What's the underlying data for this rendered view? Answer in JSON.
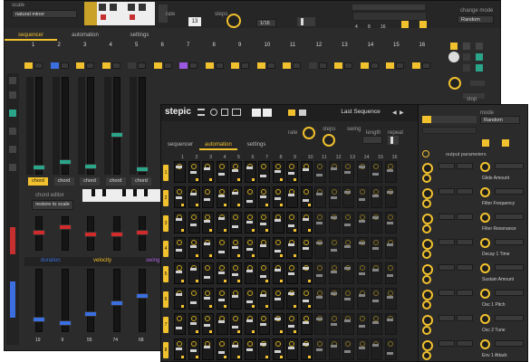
{
  "back": {
    "scale_label": "scale",
    "scale_value": "natural minor",
    "tabs": [
      "sequencer",
      "automation",
      "settings"
    ],
    "active_tab": 0,
    "track_numbers": [
      "1",
      "2",
      "3",
      "4",
      "5",
      "6",
      "7",
      "8",
      "9",
      "10",
      "11",
      "12",
      "13",
      "14",
      "15",
      "16"
    ],
    "value_readout": "13",
    "rate_label": "rate",
    "steps_label": "steps",
    "rate_value": "1/16",
    "chord_btn": "chord",
    "chord_editor_label": "chord editor",
    "restore_btn": "restore to scale",
    "section_tabs": [
      "duration",
      "velocity",
      "swing"
    ],
    "section_colors": [
      "#3b6fe0",
      "#f2c12e",
      "#b36ae8"
    ],
    "bottom_values": [
      "19",
      "9",
      "55",
      "74",
      "68",
      "38",
      "33",
      "74"
    ],
    "right_labels": [
      "change mode",
      "Random"
    ],
    "right_small": [
      "stop"
    ],
    "gray_labels": [
      "4",
      "8",
      "16"
    ]
  },
  "front": {
    "logo": "stepic",
    "preset_name": "Last Sequence",
    "tabs": [
      "sequencer",
      "automation",
      "settings"
    ],
    "labels": [
      "rate",
      "steps",
      "swing",
      "length",
      "repeat"
    ],
    "step_numbers": [
      "1",
      "2",
      "3",
      "4",
      "5",
      "6",
      "7",
      "8",
      "9",
      "10",
      "11",
      "12",
      "13",
      "14",
      "15",
      "16"
    ],
    "lanes": [
      "1",
      "2",
      "3",
      "4",
      "5",
      "6",
      "7",
      "8"
    ],
    "right_header": "output parameters",
    "channel_names": [
      "Glide Amount",
      "Filter Frequency",
      "Filter Resonance",
      "Decay 1 Time",
      "Sustain Amount",
      "Osc 1 Pitch",
      "Osc 2 Tune",
      "Env 1 Attack"
    ],
    "mode_label": "mode",
    "mode_value": "Random"
  },
  "colors": {
    "accent": "#f2c12e",
    "blue": "#3b6fe0",
    "red": "#d02a2a",
    "green": "#2aa58a",
    "purple": "#9b58e0",
    "panel": "#2b2b2b"
  }
}
